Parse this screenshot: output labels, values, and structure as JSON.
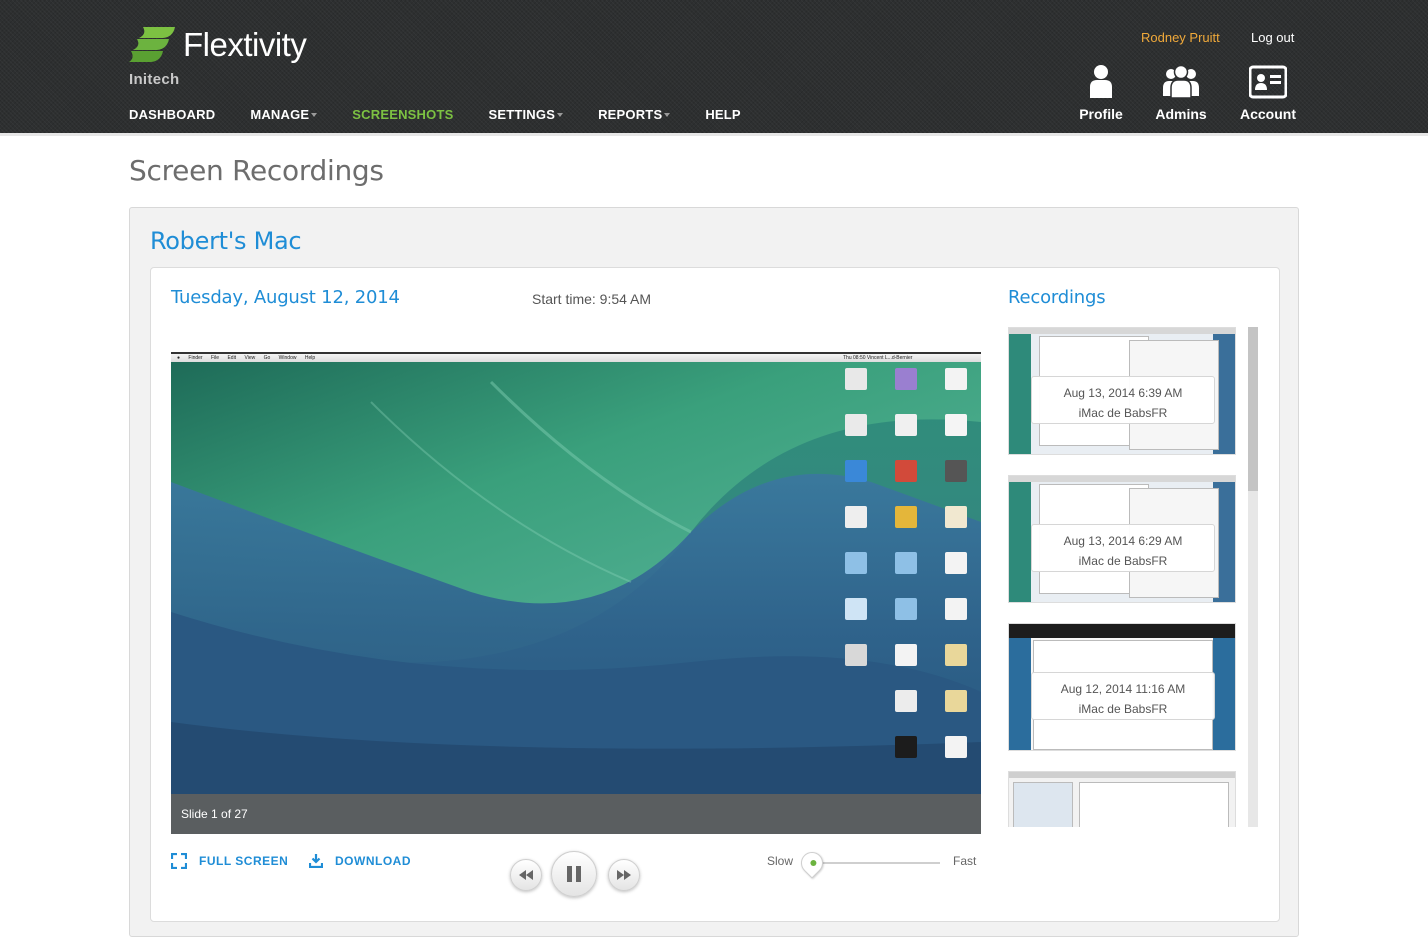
{
  "header": {
    "brand": "Flextivity",
    "organization": "Initech",
    "nav": [
      {
        "label": "DASHBOARD",
        "dropdown": false,
        "active": false
      },
      {
        "label": "MANAGE",
        "dropdown": true,
        "active": false
      },
      {
        "label": "SCREENSHOTS",
        "dropdown": false,
        "active": true
      },
      {
        "label": "SETTINGS",
        "dropdown": true,
        "active": false
      },
      {
        "label": "REPORTS",
        "dropdown": true,
        "active": false
      },
      {
        "label": "HELP",
        "dropdown": false,
        "active": false
      }
    ],
    "user_name": "Rodney Pruitt",
    "logout_label": "Log out",
    "tools": {
      "profile": {
        "label": "Profile",
        "icon": "person-icon"
      },
      "admins": {
        "label": "Admins",
        "icon": "group-icon"
      },
      "account": {
        "label": "Account",
        "icon": "id-card-icon"
      }
    },
    "colors": {
      "active_nav": "#7cc142",
      "user_name": "#f0a93a",
      "accent_blue": "#1f8dd6"
    }
  },
  "page": {
    "title": "Screen Recordings",
    "device_name": "Robert's Mac",
    "date": "Tuesday, August 12, 2014",
    "start_time": "Start time: 9:54 AM",
    "recordings_title": "Recordings"
  },
  "player": {
    "slide_counter": "Slide 1 of 27",
    "desktop_menubar": [
      "Finder",
      "File",
      "Edit",
      "View",
      "Go",
      "Window",
      "Help"
    ],
    "desktop_clock": "Thu 08:50  Vincent L...d-Bernier",
    "fullscreen_label": "FULL SCREEN",
    "download_label": "DOWNLOAD",
    "speed_slow_label": "Slow",
    "speed_fast_label": "Fast",
    "speed_value": 0
  },
  "recordings": [
    {
      "time": "Aug 13, 2014 6:39 AM",
      "device": "iMac de BabsFR"
    },
    {
      "time": "Aug 13, 2014 6:29 AM",
      "device": "iMac de BabsFR"
    },
    {
      "time": "Aug 12, 2014 11:16 AM",
      "device": "iMac de BabsFR"
    },
    {
      "time": "",
      "device": ""
    }
  ]
}
